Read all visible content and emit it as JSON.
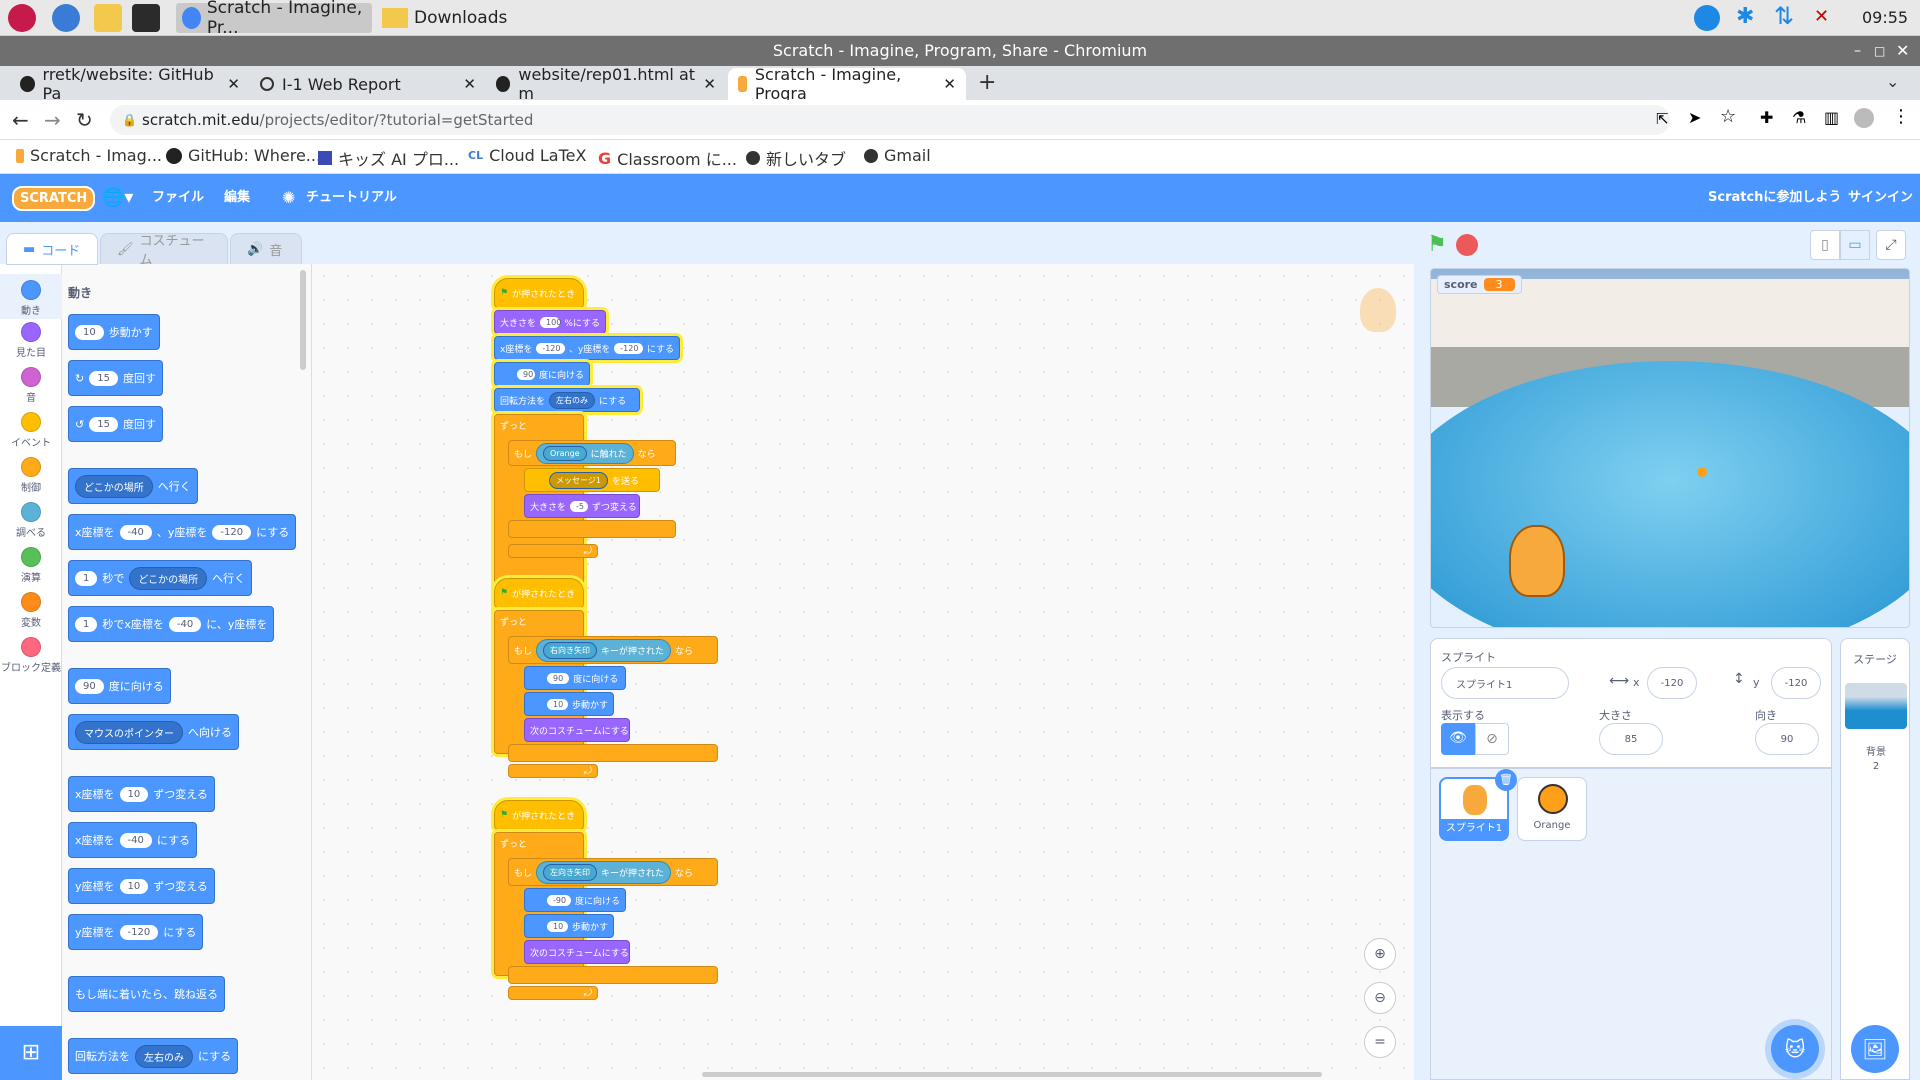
{
  "taskbar": {
    "tasks": [
      "Scratch - Imagine, Pr...",
      "Downloads"
    ],
    "clock": "09:55"
  },
  "browser": {
    "window_title": "Scratch - Imagine, Program, Share - Chromium",
    "tabs": [
      {
        "label": "rretk/website: GitHub Pa"
      },
      {
        "label": "I-1 Web Report"
      },
      {
        "label": "website/rep01.html at m"
      },
      {
        "label": "Scratch - Imagine, Progra"
      }
    ],
    "url_host": "scratch.mit.edu",
    "url_path": "/projects/editor/?tutorial=getStarted",
    "bookmarks": [
      "Scratch - Imag...",
      "GitHub: Where...",
      "キッズ AI プロ...",
      "Cloud LaTeX",
      "Classroom に...",
      "新しいタブ",
      "Gmail"
    ]
  },
  "menu": {
    "logo": "SCRATCH",
    "file": "ファイル",
    "edit": "編集",
    "tutorial": "チュートリアル",
    "join": "Scratchに参加しよう",
    "signin": "サインイン"
  },
  "editor_tabs": {
    "code": "コード",
    "costume": "コスチューム",
    "sound": "音"
  },
  "categories": [
    {
      "label": "動き",
      "color": "#4c97ff"
    },
    {
      "label": "見た目",
      "color": "#9966ff"
    },
    {
      "label": "音",
      "color": "#cf63cf"
    },
    {
      "label": "イベント",
      "color": "#ffbf00"
    },
    {
      "label": "制御",
      "color": "#ffab19"
    },
    {
      "label": "調べる",
      "color": "#5cb1d6"
    },
    {
      "label": "演算",
      "color": "#59c059"
    },
    {
      "label": "変数",
      "color": "#ff8c1a"
    },
    {
      "label": "ブロック定義",
      "color": "#ff6680"
    }
  ],
  "palette": {
    "heading": "動き",
    "move": {
      "val": "10",
      "text": "歩動かす"
    },
    "turn_right": {
      "val": "15",
      "text": "度回す"
    },
    "turn_left": {
      "val": "15",
      "text": "度回す"
    },
    "goto": {
      "dd": "どこかの場所",
      "text": "へ行く"
    },
    "gotoxy": {
      "t1": "x座標を",
      "x": "-40",
      "t2": "、y座標を",
      "y": "-120",
      "t3": "にする"
    },
    "glide": {
      "val": "1",
      "t1": "秒で",
      "dd": "どこかの場所",
      "t2": "へ行く"
    },
    "glidexy": {
      "val": "1",
      "t1": "秒でx座標を",
      "x": "-40",
      "t2": "に、y座標を"
    },
    "point": {
      "val": "90",
      "text": "度に向ける"
    },
    "pointto": {
      "dd": "マウスのポインター",
      "text": "へ向ける"
    },
    "changex": {
      "t1": "x座標を",
      "val": "10",
      "t2": "ずつ変える"
    },
    "setx": {
      "t1": "x座標を",
      "val": "-40",
      "t2": "にする"
    },
    "changey": {
      "t1": "y座標を",
      "val": "10",
      "t2": "ずつ変える"
    },
    "sety": {
      "t1": "y座標を",
      "val": "-120",
      "t2": "にする"
    },
    "bounce": {
      "text": "もし端に着いたら、跳ね返る"
    },
    "rotstyle": {
      "t1": "回転方法を",
      "dd": "左右のみ",
      "t2": "にする"
    }
  },
  "scripts": {
    "s1": {
      "hat": "が押されたとき",
      "size": {
        "t1": "大きさを",
        "val": "100",
        "t2": "%にする"
      },
      "gotoxy": {
        "t1": "x座標を",
        "x": "-120",
        "t2": "、y座標を",
        "y": "-120",
        "t3": "にする"
      },
      "point": {
        "val": "90",
        "text": "度に向ける"
      },
      "rot": {
        "t1": "回転方法を",
        "dd": "左右のみ",
        "t2": "にする"
      },
      "forever": "ずっと",
      "if": "もし",
      "touch": {
        "dd": "Orange",
        "text": "に触れた"
      },
      "then": "なら",
      "broadcast": {
        "dd": "メッセージ1",
        "text": "を送る"
      },
      "chsize": {
        "t1": "大きさを",
        "val": "-5",
        "t2": "ずつ変える"
      }
    },
    "s2": {
      "hat": "が押されたとき",
      "forever": "ずっと",
      "if": "もし",
      "key": {
        "dd": "右向き矢印",
        "text": "キーが押された"
      },
      "then": "なら",
      "point": {
        "val": "90",
        "text": "度に向ける"
      },
      "move": {
        "val": "10",
        "text": "歩動かす"
      },
      "costume": "次のコスチュームにする"
    },
    "s3": {
      "hat": "が押されたとき",
      "forever": "ずっと",
      "if": "もし",
      "key": {
        "dd": "左向き矢印",
        "text": "キーが押された"
      },
      "then": "なら",
      "point": {
        "val": "-90",
        "text": "度に向ける"
      },
      "move": {
        "val": "10",
        "text": "歩動かす"
      },
      "costume": "次のコスチュームにする"
    }
  },
  "stage": {
    "var_name": "score",
    "var_value": "3"
  },
  "sprite_info": {
    "title": "スプライト",
    "name": "スプライト1",
    "x_label": "x",
    "x": "-120",
    "y_label": "y",
    "y": "-120",
    "show_label": "表示する",
    "size_label": "大きさ",
    "size": "85",
    "dir_label": "向き",
    "dir": "90"
  },
  "sprites": [
    {
      "name": "スプライト1"
    },
    {
      "name": "Orange"
    }
  ],
  "stage_panel": {
    "title": "ステージ",
    "backdrop_label": "背景",
    "backdrop_count": "2"
  }
}
